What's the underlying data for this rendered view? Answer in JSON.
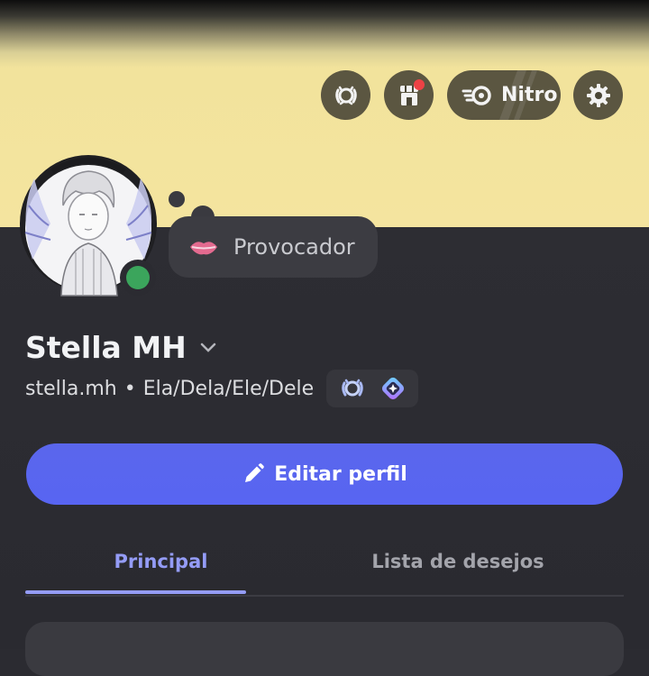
{
  "header": {
    "buttons": [
      {
        "name": "laurel-badge-button",
        "icon": "laurel-icon"
      },
      {
        "name": "shop-button",
        "icon": "shop-icon",
        "notification": true
      },
      {
        "name": "nitro-button",
        "icon": "nitro-icon",
        "label": "Nitro"
      },
      {
        "name": "settings-button",
        "icon": "gear-icon"
      }
    ]
  },
  "profile": {
    "display_name": "Stella MH",
    "username": "stella.mh",
    "separator": "•",
    "pronouns": "Ela/Dela/Ele/Dele",
    "status_text": "Provocador",
    "status_emoji": "lips-emoji",
    "presence": "online",
    "badges": [
      "laurel-badge-icon",
      "quest-badge-icon"
    ]
  },
  "actions": {
    "edit_label": "Editar perfil"
  },
  "tabs": [
    {
      "label": "Principal",
      "active": true
    },
    {
      "label": "Lista de desejos",
      "active": false
    }
  ],
  "colors": {
    "banner": "#f4e49f",
    "accent": "#5865f2",
    "tab_active": "#949cf7",
    "online": "#3ba55c",
    "notification": "#ed4245"
  }
}
